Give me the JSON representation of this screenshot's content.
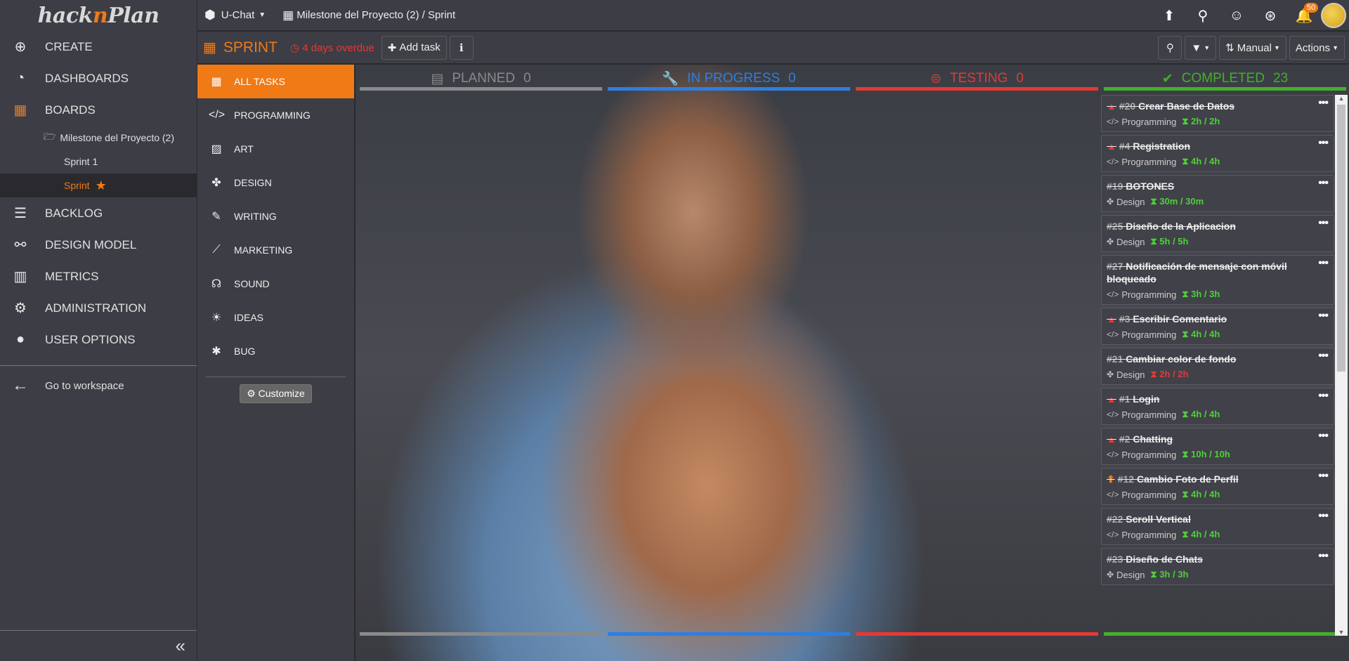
{
  "brand": {
    "logo_pre": "hack",
    "logo_n": "n",
    "logo_post": "Plan"
  },
  "leftnav": {
    "items": [
      {
        "label": "CREATE",
        "icon": "plus-circle-icon"
      },
      {
        "label": "DASHBOARDS",
        "icon": "dashboard-icon"
      },
      {
        "label": "BOARDS",
        "icon": "boards-icon"
      },
      {
        "label": "BACKLOG",
        "icon": "list-icon"
      },
      {
        "label": "DESIGN MODEL",
        "icon": "sitemap-icon"
      },
      {
        "label": "METRICS",
        "icon": "bar-chart-icon"
      },
      {
        "label": "ADMINISTRATION",
        "icon": "gear-icon"
      },
      {
        "label": "USER OPTIONS",
        "icon": "user-icon"
      }
    ],
    "milestone": "Milestone del Proyecto (2)",
    "sprints": [
      {
        "label": "Sprint 1"
      },
      {
        "label": "Sprint"
      }
    ],
    "workspace": "Go to workspace"
  },
  "topbar": {
    "project": "U-Chat",
    "breadcrumb": "Milestone del Proyecto (2) / Sprint",
    "notifications": "50"
  },
  "sprintbar": {
    "title": "SPRINT",
    "overdue": "4 days overdue",
    "add_task": "Add task",
    "sort": "Manual",
    "actions": "Actions"
  },
  "categories": [
    {
      "label": "ALL TASKS",
      "icon": "grid-icon"
    },
    {
      "label": "PROGRAMMING",
      "icon": "code-icon"
    },
    {
      "label": "ART",
      "icon": "image-icon"
    },
    {
      "label": "DESIGN",
      "icon": "puzzle-icon"
    },
    {
      "label": "WRITING",
      "icon": "pencil-icon"
    },
    {
      "label": "MARKETING",
      "icon": "line-chart-icon"
    },
    {
      "label": "SOUND",
      "icon": "headphones-icon"
    },
    {
      "label": "IDEAS",
      "icon": "lightbulb-icon"
    },
    {
      "label": "BUG",
      "icon": "bug-icon"
    }
  ],
  "customize": "Customize",
  "columns": [
    {
      "label": "PLANNED",
      "count": "0",
      "color": "#8a8a8a"
    },
    {
      "label": "IN PROGRESS",
      "count": "0",
      "color": "#2f7ee0"
    },
    {
      "label": "TESTING",
      "count": "0",
      "color": "#e53935"
    },
    {
      "label": "COMPLETED",
      "count": "23",
      "color": "#43b02a"
    }
  ],
  "cards": [
    {
      "num": "#20",
      "title": "Crear Base de Datos",
      "category": "Programming",
      "hours": "2h / 2h",
      "priority": "high",
      "hours_color": "#4cd137"
    },
    {
      "num": "#4",
      "title": "Registration",
      "category": "Programming",
      "hours": "4h / 4h",
      "priority": "high",
      "hours_color": "#4cd137"
    },
    {
      "num": "#19",
      "title": "BOTONES",
      "category": "Design",
      "hours": "30m / 30m",
      "priority": "",
      "hours_color": "#4cd137"
    },
    {
      "num": "#25",
      "title": "Diseño de la Aplicacion",
      "category": "Design",
      "hours": "5h / 5h",
      "priority": "",
      "hours_color": "#4cd137"
    },
    {
      "num": "#27",
      "title": "Notificación de mensaje con móvil bloqueado",
      "category": "Programming",
      "hours": "3h / 3h",
      "priority": "",
      "hours_color": "#4cd137"
    },
    {
      "num": "#3",
      "title": "Escribir Comentario",
      "category": "Programming",
      "hours": "4h / 4h",
      "priority": "high",
      "hours_color": "#4cd137"
    },
    {
      "num": "#21",
      "title": "Cambiar color de fondo",
      "category": "Design",
      "hours": "2h / 2h",
      "priority": "",
      "hours_color": "#e53935"
    },
    {
      "num": "#1",
      "title": "Login",
      "category": "Programming",
      "hours": "4h / 4h",
      "priority": "high",
      "hours_color": "#4cd137"
    },
    {
      "num": "#2",
      "title": "Chatting",
      "category": "Programming",
      "hours": "10h / 10h",
      "priority": "high",
      "hours_color": "#4cd137"
    },
    {
      "num": "#12",
      "title": "Cambio Foto de Perfil",
      "category": "Programming",
      "hours": "4h / 4h",
      "priority": "up",
      "hours_color": "#4cd137"
    },
    {
      "num": "#22",
      "title": "Scroll Vertical",
      "category": "Programming",
      "hours": "4h / 4h",
      "priority": "",
      "hours_color": "#4cd137"
    },
    {
      "num": "#23",
      "title": "Diseño de Chats",
      "category": "Design",
      "hours": "3h / 3h",
      "priority": "",
      "hours_color": "#4cd137"
    }
  ]
}
